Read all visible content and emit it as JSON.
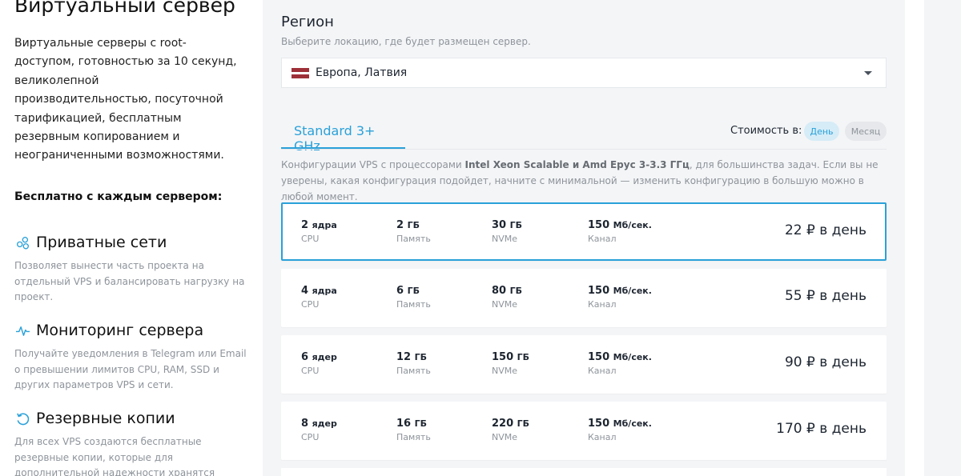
{
  "left": {
    "title": "Виртуальный сервер",
    "intro": "Виртуальные серверы с root-доступом, готовностью за 10 секунд, великолепной производительностью, посуточной тарификацией, бесплатным резервным копированием и неограниченными возможностями.",
    "free_heading": "Бесплатно с каждым сервером:",
    "features": [
      {
        "icon": "private-network-icon",
        "title": "Приватные сети",
        "desc": "Позволяет вынести часть проекта на отдельный VPS и балансировать нагрузку на проект."
      },
      {
        "icon": "monitoring-pulse-icon",
        "title": "Мониторинг сервера",
        "desc": "Получайте уведомления в Telegram или Email о превышении лимитов CPU, RAM, SSD и других параметров VPS и сети."
      },
      {
        "icon": "backup-refresh-icon",
        "title": "Резервные копии",
        "desc": "Для всех VPS создаются бесплатные резервные копии, которые для дополнительной надежности хранятся"
      }
    ]
  },
  "region": {
    "title": "Регион",
    "subtitle": "Выберите локацию, где будет размещен сервер.",
    "selected": "Европа, Латвия"
  },
  "tab": {
    "label": "Standard 3+ GHz"
  },
  "cost": {
    "label": "Стоимость в:",
    "day": "День",
    "month": "Месяц"
  },
  "description": {
    "part1": "Конфигурации VPS с процессорами ",
    "bold": "Intel Xeon Scalable и Amd Epyc 3-3.3 ГГц",
    "part2": ", для большинства задач. Если вы не уверены, какая конфигурация подойдет, начните с минимальной — изменить конфигурацию в большую можно в любой момент."
  },
  "plans": [
    {
      "cpu": "2",
      "cpu_unit": "ядра",
      "ram": "2",
      "ram_unit": "ГБ",
      "disk": "30",
      "disk_unit": "ГБ",
      "net": "150",
      "net_unit": "Мб/сек.",
      "price": "22 ₽ в день"
    },
    {
      "cpu": "4",
      "cpu_unit": "ядра",
      "ram": "6",
      "ram_unit": "ГБ",
      "disk": "80",
      "disk_unit": "ГБ",
      "net": "150",
      "net_unit": "Мб/сек.",
      "price": "55 ₽ в день"
    },
    {
      "cpu": "6",
      "cpu_unit": "ядер",
      "ram": "12",
      "ram_unit": "ГБ",
      "disk": "150",
      "disk_unit": "ГБ",
      "net": "150",
      "net_unit": "Мб/сек.",
      "price": "90 ₽ в день"
    },
    {
      "cpu": "8",
      "cpu_unit": "ядер",
      "ram": "16",
      "ram_unit": "ГБ",
      "disk": "220",
      "disk_unit": "ГБ",
      "net": "150",
      "net_unit": "Мб/сек.",
      "price": "170 ₽ в день"
    }
  ],
  "labels": {
    "cpu": "CPU",
    "ram": "Память",
    "disk": "NVMe",
    "net": "Канал"
  },
  "colors": {
    "accent": "#2aa1d9",
    "panel": "#f4f5f7",
    "muted": "#8e949b"
  }
}
